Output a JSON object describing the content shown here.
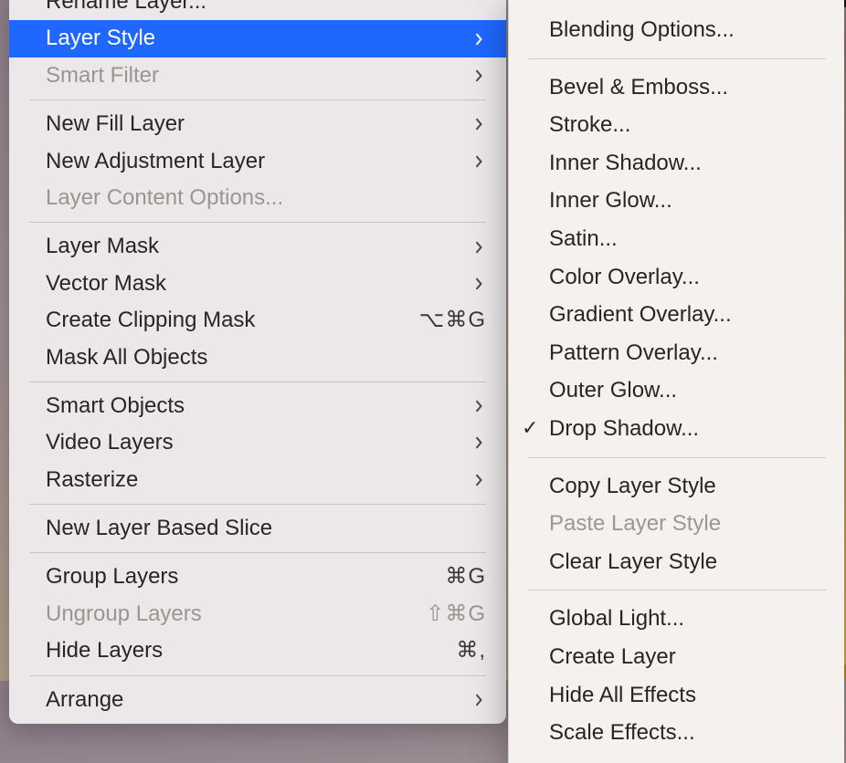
{
  "primary_menu": {
    "sections": [
      {
        "items": [
          {
            "label": "Rename Layer...",
            "has_submenu": false
          },
          {
            "label": "Layer Style",
            "has_submenu": true,
            "highlighted": true
          },
          {
            "label": "Smart Filter",
            "has_submenu": true,
            "disabled": true
          }
        ]
      },
      {
        "items": [
          {
            "label": "New Fill Layer",
            "has_submenu": true
          },
          {
            "label": "New Adjustment Layer",
            "has_submenu": true
          },
          {
            "label": "Layer Content Options...",
            "disabled": true
          }
        ]
      },
      {
        "items": [
          {
            "label": "Layer Mask",
            "has_submenu": true
          },
          {
            "label": "Vector Mask",
            "has_submenu": true
          },
          {
            "label": "Create Clipping Mask",
            "shortcut": "⌥⌘G"
          },
          {
            "label": "Mask All Objects"
          }
        ]
      },
      {
        "items": [
          {
            "label": "Smart Objects",
            "has_submenu": true
          },
          {
            "label": "Video Layers",
            "has_submenu": true
          },
          {
            "label": "Rasterize",
            "has_submenu": true
          }
        ]
      },
      {
        "items": [
          {
            "label": "New Layer Based Slice"
          }
        ]
      },
      {
        "items": [
          {
            "label": "Group Layers",
            "shortcut": "⌘G"
          },
          {
            "label": "Ungroup Layers",
            "shortcut": "⇧⌘G",
            "disabled": true
          },
          {
            "label": "Hide Layers",
            "shortcut": "⌘,"
          }
        ]
      },
      {
        "items": [
          {
            "label": "Arrange",
            "has_submenu": true
          }
        ]
      }
    ]
  },
  "sub_menu": {
    "sections": [
      {
        "items": [
          {
            "label": "Blending Options..."
          }
        ]
      },
      {
        "items": [
          {
            "label": "Bevel & Emboss..."
          },
          {
            "label": "Stroke..."
          },
          {
            "label": "Inner Shadow..."
          },
          {
            "label": "Inner Glow..."
          },
          {
            "label": "Satin..."
          },
          {
            "label": "Color Overlay..."
          },
          {
            "label": "Gradient Overlay..."
          },
          {
            "label": "Pattern Overlay..."
          },
          {
            "label": "Outer Glow..."
          },
          {
            "label": "Drop Shadow...",
            "checked": true
          }
        ]
      },
      {
        "items": [
          {
            "label": "Copy Layer Style"
          },
          {
            "label": "Paste Layer Style",
            "disabled": true
          },
          {
            "label": "Clear Layer Style"
          }
        ]
      },
      {
        "items": [
          {
            "label": "Global Light..."
          },
          {
            "label": "Create Layer"
          },
          {
            "label": "Hide All Effects"
          },
          {
            "label": "Scale Effects..."
          }
        ]
      }
    ]
  }
}
